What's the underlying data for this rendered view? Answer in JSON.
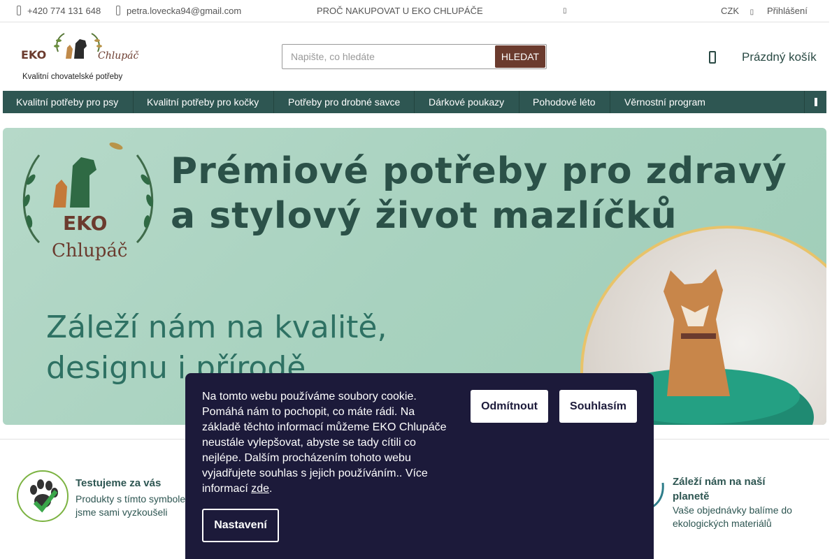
{
  "topbar": {
    "phone": "+420 774 131 648",
    "email": "petra.lovecka94@gmail.com",
    "why_link": "PROČ NAKUPOVAT U EKO CHLUPÁČE",
    "currency": "CZK",
    "login": "Přihlášení"
  },
  "logo": {
    "brand_left": "EKO",
    "brand_right": "Chlupáč",
    "tagline": "Kvalitní chovatelské potřeby"
  },
  "search": {
    "placeholder": "Napište, co hledáte",
    "button": "HLEDAT"
  },
  "cart": {
    "label": "Prázdný košík"
  },
  "nav": {
    "items": [
      "Kvalitní potřeby pro psy",
      "Kvalitní potřeby pro kočky",
      "Potřeby pro drobné savce",
      "Dárkové poukazy",
      "Pohodové léto",
      "Věrnostní program"
    ]
  },
  "banner": {
    "headline_1": "Prémiové potřeby pro zdravý",
    "headline_2": "a stylový život mazlíčků",
    "sub_1": "Záleží nám na kvalitě,",
    "sub_2": "designu i přírodě",
    "logo_eko": "EKO",
    "logo_name": "Chlupáč"
  },
  "features": [
    {
      "title": "Testujeme za vás",
      "desc": "Produkty s tímto symbolem jsme sami vyzkoušeli"
    },
    {
      "title": "Záleží nám na naší planetě",
      "desc": "Vaše objednávky balíme do ekologických materiálů"
    }
  ],
  "cookie": {
    "text": "Na tomto webu používáme soubory cookie. Pomáhá nám to pochopit, co máte rádi. Na základě těchto informací můžeme EKO Chlupáče neustále vylepšovat, abyste se tady cítili co nejlépe. Dalším procházením tohoto webu vyjadřujete souhlas s jejich používáním.. Více informací ",
    "link": "zde",
    "after_link": ".",
    "decline": "Odmítnout",
    "accept": "Souhlasím",
    "settings": "Nastavení"
  },
  "colors": {
    "nav_bg": "#2e5652",
    "search_button": "#6b3b2e",
    "cookie_bg": "#1c1a3a",
    "banner_bg": "#a8d2bf"
  }
}
